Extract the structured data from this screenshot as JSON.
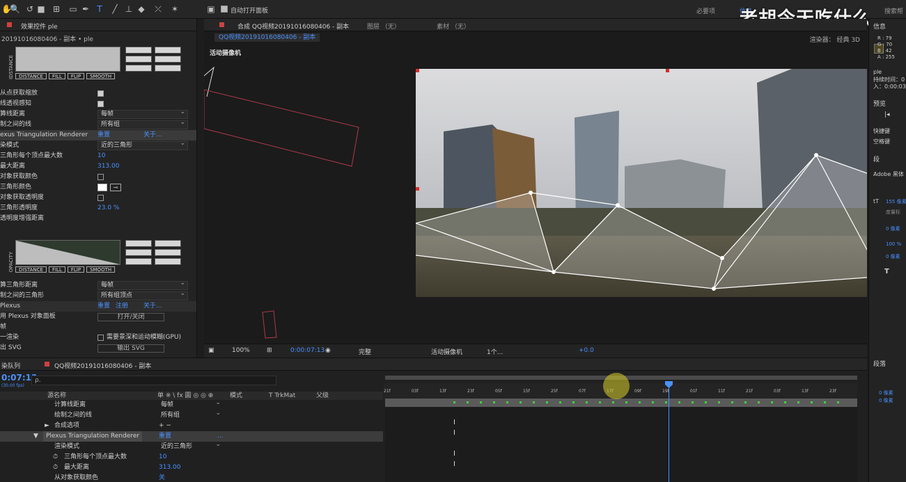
{
  "toolbar": {
    "auto_open_label": "自动打开面板",
    "workspace_required": "必要项",
    "workspace_info": "信息",
    "search_label": "搜索帮"
  },
  "watermark": "老胡今天吃什么",
  "effects_panel": {
    "tab": "效果控件 ple",
    "layer_path": "20191016080406 - 副本 • ple",
    "graph_side_label": "IDSTANCE",
    "graph_buttons": [
      "DISTANCE",
      "FILL",
      "FLIP",
      "SMOOTH"
    ],
    "rows": [
      {
        "label": "从点获取缩放",
        "type": "checkbox",
        "checked": true
      },
      {
        "label": "线透视感知",
        "type": "checkbox",
        "checked": true
      },
      {
        "label": "算线距离",
        "type": "dropdown",
        "value": "每帧"
      },
      {
        "label": "制之间的线",
        "type": "dropdown",
        "value": "所有组"
      }
    ],
    "renderer_section": {
      "label": "exus Triangulation Renderer",
      "reset": "重置",
      "about": "关于..."
    },
    "renderer_rows": [
      {
        "label": "染模式",
        "type": "dropdown",
        "value": "近的三角形"
      },
      {
        "label": "三角形每个顶点最大数",
        "type": "value",
        "value": "10"
      },
      {
        "label": "最大距离",
        "type": "value",
        "value": "313.00"
      },
      {
        "label": "对象获取颜色",
        "type": "checkbox",
        "checked": false
      },
      {
        "label": "三角形颜色",
        "type": "color",
        "value": "#ffffff"
      },
      {
        "label": "对象获取透明度",
        "type": "checkbox",
        "checked": false
      },
      {
        "label": "三角形透明度",
        "type": "value",
        "value": "23.0 %"
      },
      {
        "label": "透明度增强距离",
        "type": "text",
        "value": ""
      }
    ],
    "graph2_side_label": "OPACITY",
    "lower_rows": [
      {
        "label": "算三角形距离",
        "type": "dropdown",
        "value": "每帧"
      },
      {
        "label": "制之间的三角形",
        "type": "dropdown",
        "value": "所有组顶点"
      }
    ],
    "plexus_section": {
      "label": "Plexus",
      "reset": "重置",
      "register": "注册",
      "about": "关于..."
    },
    "plexus_rows": [
      {
        "label": "用 Plexus 对象面板",
        "button": "打开/关闭"
      },
      {
        "label": "帧",
        "button": ""
      },
      {
        "label": "一渲染",
        "checkbox_label": "需要景深和运动模糊(GPU)"
      },
      {
        "label": "出 SVG",
        "button": "输出 SVG"
      }
    ]
  },
  "comp_panel": {
    "tab_comp": "合成 QQ视频20191016080406 - 副本",
    "tab_layer": "图层 （无）",
    "tab_footage": "素材 （无）",
    "sub_tab": "QQ视频20191016080406 - 副本",
    "renderer_label": "渲染器： 经典 3D",
    "camera_label": "活动摄像机",
    "footer": {
      "zoom": "100%",
      "timecode": "0:00:07:13",
      "quality": "完整",
      "view": "活动摄像机",
      "views": "1个...",
      "exposure": "+0.0"
    }
  },
  "info_panel": {
    "rgb": [
      "R : 79",
      "G : 70",
      "B : 42",
      "A : 255"
    ],
    "swatch_color": "#4f4620",
    "layer_name": "ple",
    "duration": "持续时间：0",
    "in_point": "入：0:00:03",
    "preview_tab": "预览",
    "shortcut_label": "快捷键",
    "shortcut_value": "空格键",
    "character_tab": "段",
    "font_name": "Adobe 黑体",
    "font_size": "155 像素",
    "tracking": "度量标",
    "stroke": "0 像素",
    "vertical_scale": "100 %",
    "baseline": "0 像素",
    "paragraph_tab": "段落",
    "indent1": "0 像素",
    "indent2": "0 像素"
  },
  "timeline": {
    "tab_render": "染队列",
    "tab_comp": "QQ视频20191016080406 - 副本",
    "timecode": "0:07:13",
    "fps": "(30.00 fps)",
    "search_placeholder": "ρ.",
    "col_layer_name": "源名称",
    "col_switches": "单 ※ \\ fx 圓 ◎ ◎ ⊕",
    "col_mode": "模式",
    "col_trkmat": "T  TrkMat",
    "col_parent": "父级",
    "ruler_labels": [
      "21f",
      "03f",
      "13f",
      "23f",
      "05f",
      "15f",
      "25f",
      "07f",
      "17f",
      "09f",
      "19f",
      "01f",
      "11f",
      "21f",
      "03f",
      "13f",
      "23f"
    ],
    "layers": [
      {
        "name": "计算线距离",
        "indent": 78,
        "kind": "dropdown",
        "value": "每帧"
      },
      {
        "name": "绘制之间的线",
        "indent": 78,
        "kind": "dropdown",
        "value": "所有组"
      },
      {
        "name": "合成选项",
        "indent": 78,
        "kind": "text",
        "value": "+ −",
        "arrow": "►"
      },
      {
        "name": "Plexus Triangulation Renderer",
        "indent": 62,
        "kind": "blue",
        "value": "重置",
        "arrow": "▼",
        "extra": "...",
        "highlight": true
      },
      {
        "name": "渲染模式",
        "indent": 78,
        "kind": "dropdown",
        "value": "近的三角形"
      },
      {
        "name": "三角形每个顶点最大数",
        "indent": 78,
        "kind": "blue",
        "value": "10",
        "stopwatch": true
      },
      {
        "name": "最大距离",
        "indent": 78,
        "kind": "blue",
        "value": "313.00",
        "stopwatch": true
      },
      {
        "name": "从对象获取颜色",
        "indent": 78,
        "kind": "blue",
        "value": "关"
      }
    ]
  }
}
